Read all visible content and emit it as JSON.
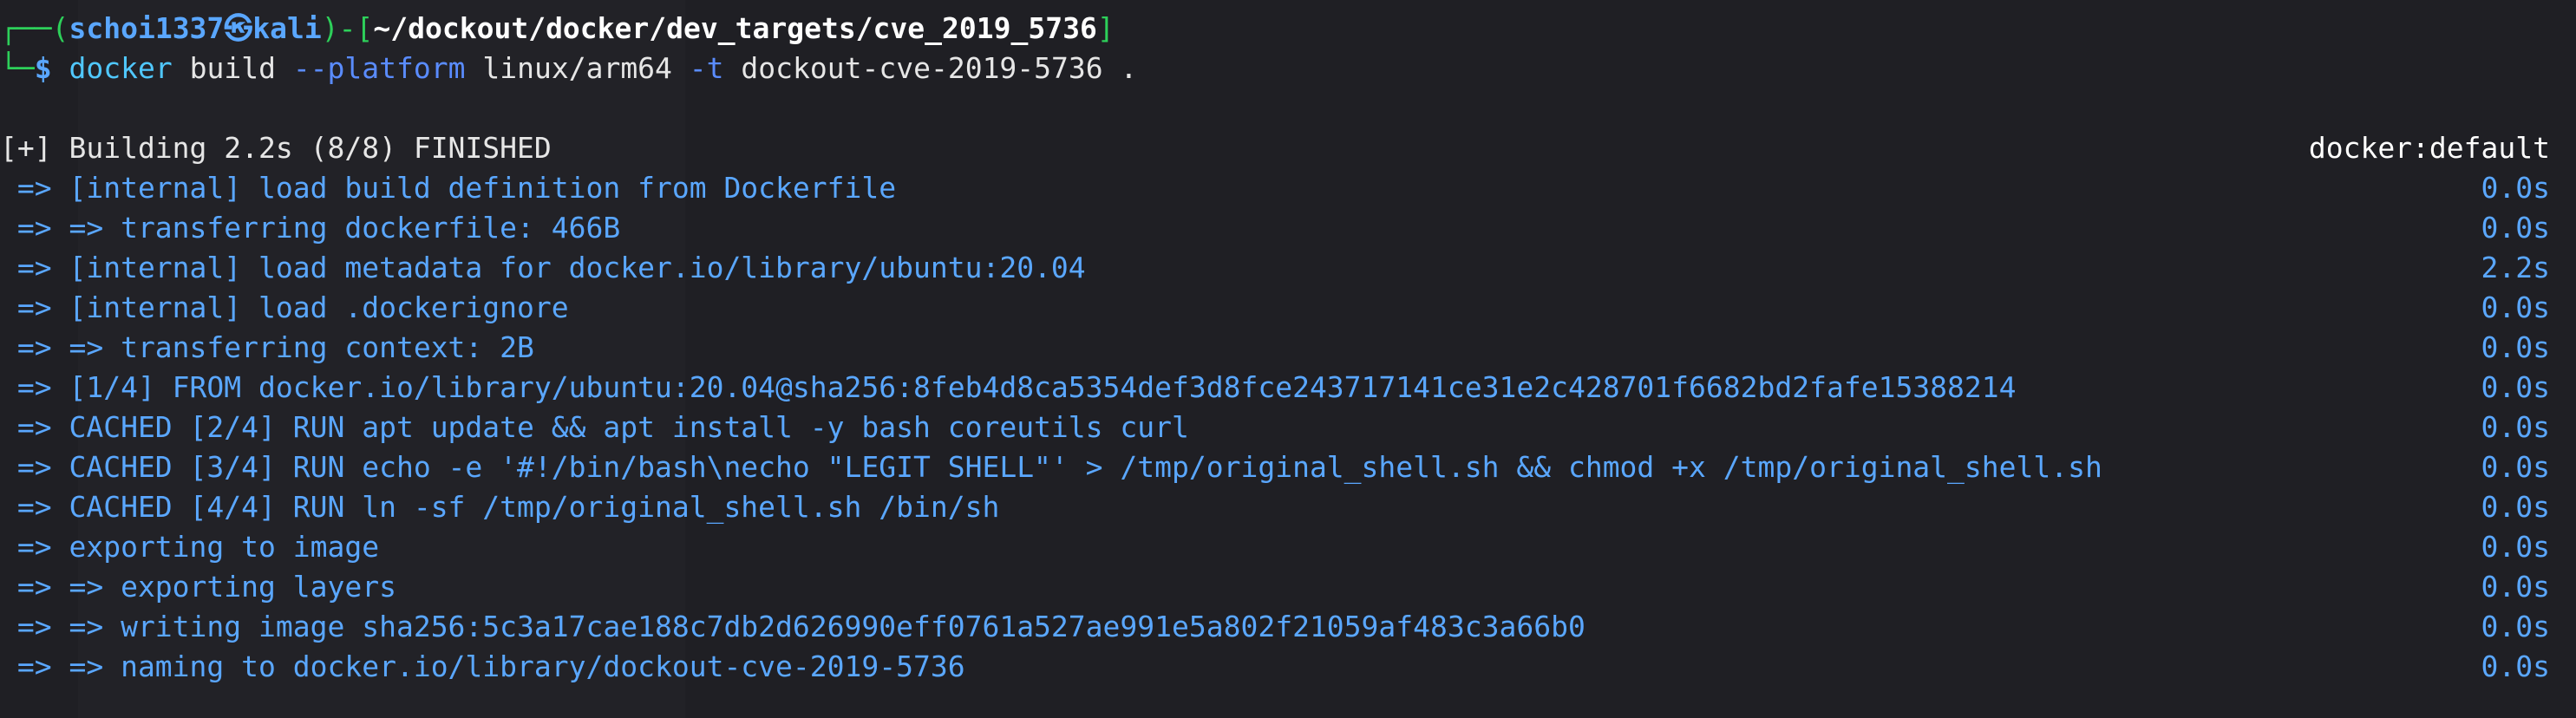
{
  "terminal": {
    "prompt": {
      "corner_top": "┌──",
      "corner_bottom": "└─",
      "open": "(",
      "user": "schoi1337",
      "at": "㉿",
      "host": "kali",
      "close": ")-[",
      "path": "~/dockout/docker/dev_targets/cve_2019_5736",
      "path_close": "]",
      "dollar": "$"
    },
    "command": {
      "program": "docker",
      "subcommand": "build",
      "flag_platform": "--platform",
      "platform_value": "linux/arm64",
      "flag_tag": "-t",
      "tag_value": "dockout-cve-2019-5736",
      "context": "."
    },
    "build_header": {
      "text": "[+] Building 2.2s (8/8) FINISHED",
      "builder": "docker:default"
    },
    "steps": [
      {
        "text": " => [internal] load build definition from Dockerfile",
        "time": "0.0s"
      },
      {
        "text": " => => transferring dockerfile: 466B",
        "time": "0.0s"
      },
      {
        "text": " => [internal] load metadata for docker.io/library/ubuntu:20.04",
        "time": "2.2s"
      },
      {
        "text": " => [internal] load .dockerignore",
        "time": "0.0s"
      },
      {
        "text": " => => transferring context: 2B",
        "time": "0.0s"
      },
      {
        "text": " => [1/4] FROM docker.io/library/ubuntu:20.04@sha256:8feb4d8ca5354def3d8fce243717141ce31e2c428701f6682bd2fafe15388214",
        "time": "0.0s"
      },
      {
        "text": " => CACHED [2/4] RUN apt update && apt install -y bash coreutils curl",
        "time": "0.0s"
      },
      {
        "text": " => CACHED [3/4] RUN echo -e '#!/bin/bash\\necho \"LEGIT SHELL\"' > /tmp/original_shell.sh && chmod +x /tmp/original_shell.sh",
        "time": "0.0s"
      },
      {
        "text": " => CACHED [4/4] RUN ln -sf /tmp/original_shell.sh /bin/sh",
        "time": "0.0s"
      },
      {
        "text": " => exporting to image",
        "time": "0.0s"
      },
      {
        "text": " => => exporting layers",
        "time": "0.0s"
      },
      {
        "text": " => => writing image sha256:5c3a17cae188c7db2d626990eff0761a527ae991e5a802f21059af483c3a66b0",
        "time": "0.0s"
      },
      {
        "text": " => => naming to docker.io/library/dockout-cve-2019-5736",
        "time": "0.0s"
      }
    ]
  }
}
